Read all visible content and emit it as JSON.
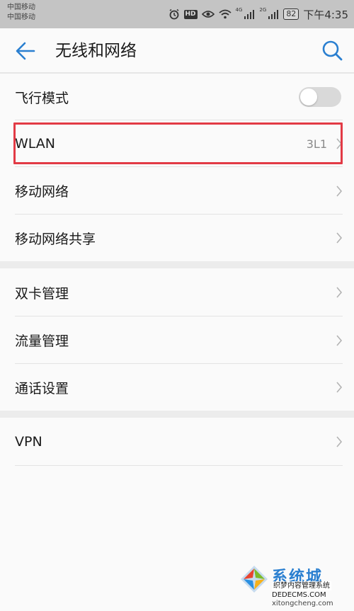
{
  "status_bar": {
    "carrier_1": "中国移动",
    "carrier_2": "中国移动",
    "net_1": "4G",
    "net_2": "2G",
    "battery": "82",
    "time": "下午4:35",
    "icons": [
      "alarm-icon",
      "hd-badge",
      "eye-icon",
      "wifi-icon",
      "signal-icon",
      "battery-icon"
    ],
    "hd_label": "HD"
  },
  "app_bar": {
    "title": "无线和网络",
    "back_icon": "arrow-left-icon",
    "search_icon": "search-icon"
  },
  "settings": {
    "airplane_mode": {
      "label": "飞行模式",
      "toggle_on": false
    },
    "wlan": {
      "label": "WLAN",
      "value": "3L1"
    },
    "mobile_network": {
      "label": "移动网络"
    },
    "tethering": {
      "label": "移动网络共享"
    },
    "dual_sim": {
      "label": "双卡管理"
    },
    "data_usage": {
      "label": "流量管理"
    },
    "call_settings": {
      "label": "通话设置"
    },
    "vpn": {
      "label": "VPN"
    }
  },
  "watermark": {
    "brand": "系统城",
    "sub": "织梦内容管理系统",
    "site": "DEDECMS.COM",
    "domain": "xitongcheng.com"
  },
  "colors": {
    "accent": "#2a7fd0",
    "highlight": "#e23a45",
    "status_bar": "#c4c4c4",
    "background": "#fafafa"
  }
}
